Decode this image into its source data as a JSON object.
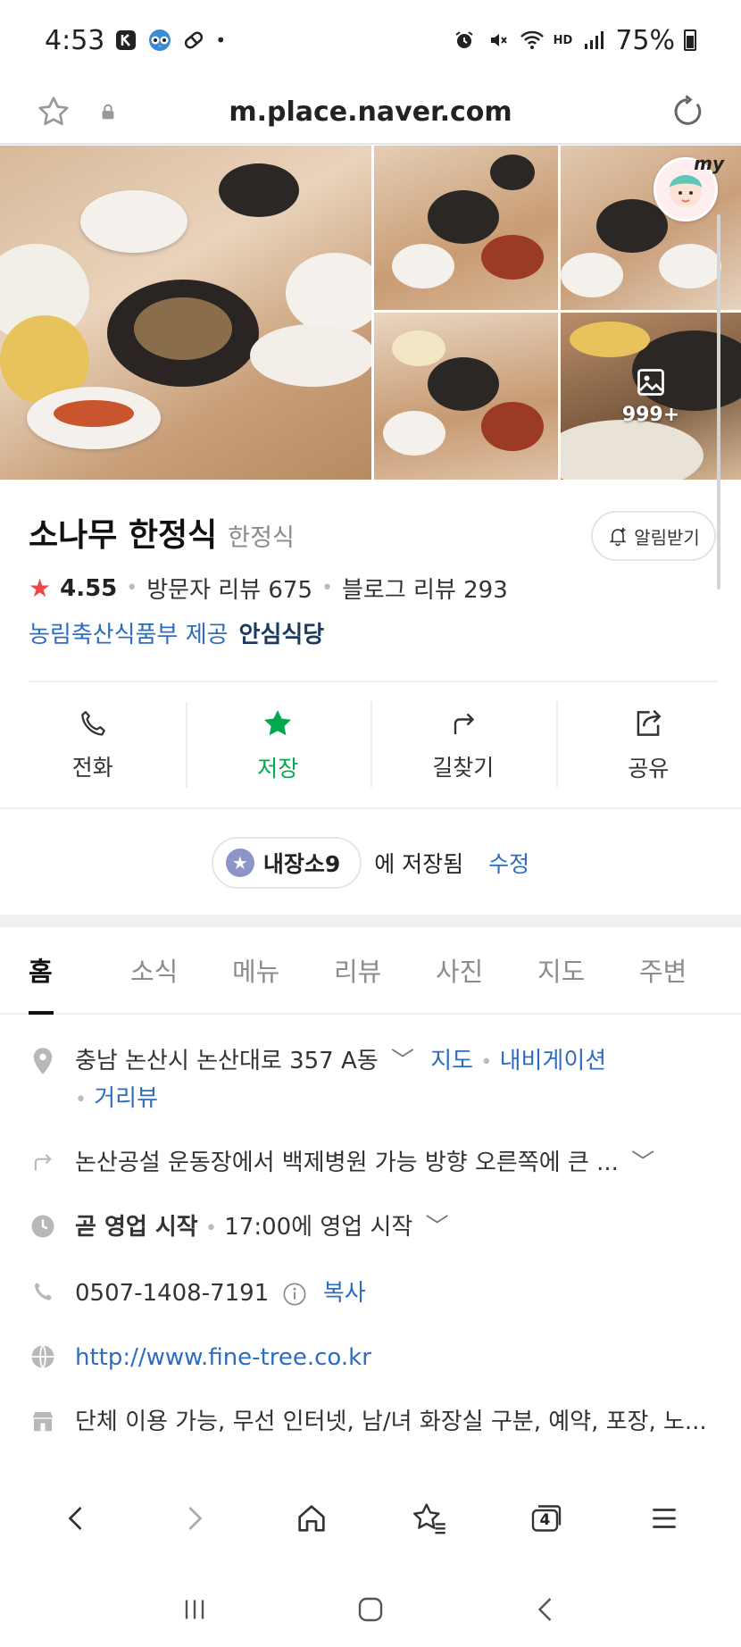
{
  "status_bar": {
    "time": "4:53",
    "battery": "75%",
    "hd_label": "HD"
  },
  "browser": {
    "url": "m.place.naver.com"
  },
  "photos": {
    "more_count": "999+",
    "avatar_label": "my"
  },
  "place": {
    "name": "소나무 한정식",
    "category": "한정식",
    "alarm_label": "알림받기",
    "rating": "4.55",
    "visitor_review": "방문자 리뷰 675",
    "blog_review": "블로그 리뷰 293",
    "safe_provider": "농림축산식품부 제공",
    "safe_badge": "안심식당"
  },
  "actions": [
    {
      "label": "전화",
      "icon": "phone-icon"
    },
    {
      "label": "저장",
      "icon": "star-icon"
    },
    {
      "label": "길찾기",
      "icon": "directions-icon"
    },
    {
      "label": "공유",
      "icon": "share-icon"
    }
  ],
  "saved": {
    "list_name": "내장소9",
    "suffix": "에 저장됨",
    "edit_label": "수정"
  },
  "tabs": [
    "홈",
    "소식",
    "메뉴",
    "리뷰",
    "사진",
    "지도",
    "주변"
  ],
  "info": {
    "address": "충남 논산시 논산대로 357 A동",
    "map_link": "지도",
    "nav_link": "내비게이션",
    "street_view": "거리뷰",
    "directions": "논산공설 운동장에서 백제병원 가능 방향 오른쪽에 큰 ...",
    "hours_status": "곧 영업 시작",
    "hours_detail": "17:00에 영업 시작",
    "phone": "0507-1408-7191",
    "copy_label": "복사",
    "website": "http://www.fine-tree.co.kr",
    "amenities": "단체 이용 가능, 무선 인터넷, 남/녀 화장실 구분, 예약, 포장, 노..."
  },
  "bottom_nav": {
    "tab_count": "4"
  },
  "colors": {
    "naver_green": "#03a94f",
    "link_blue": "#2e6cbf",
    "rating_red": "#f04545"
  }
}
